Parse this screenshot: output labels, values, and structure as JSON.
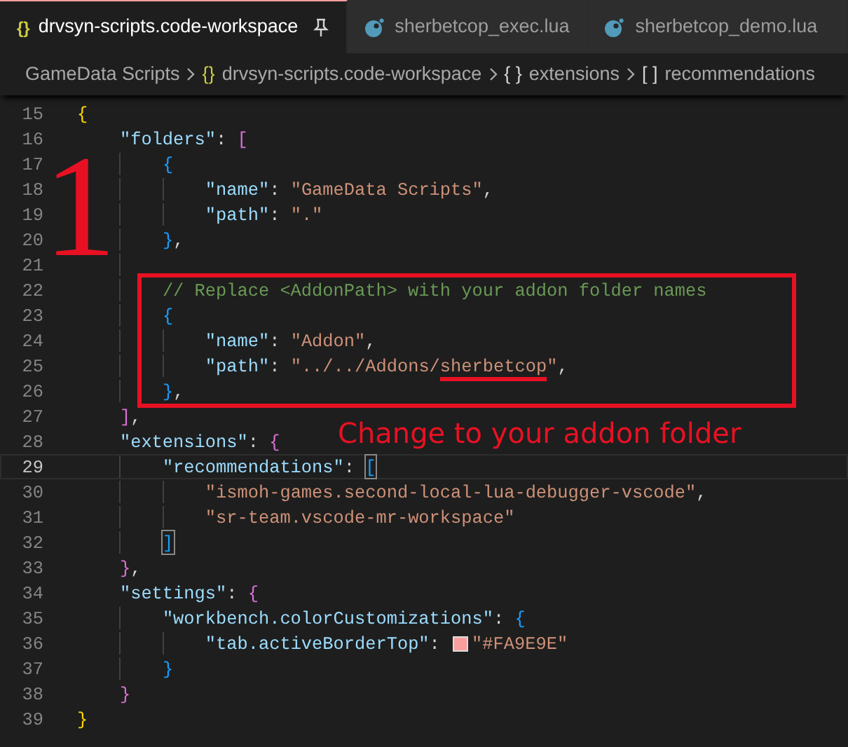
{
  "tabs": [
    {
      "label": "drvsyn-scripts.code-workspace",
      "kind": "json",
      "icon_text": "{}",
      "selected": true,
      "pinned": true
    },
    {
      "label": "sherbetcop_exec.lua",
      "kind": "lua",
      "selected": false,
      "pinned": false
    },
    {
      "label": "sherbetcop_demo.lua",
      "kind": "lua",
      "selected": false,
      "pinned": false
    }
  ],
  "breadcrumbs": [
    {
      "label": "GameData Scripts"
    },
    {
      "icon_text": "{}",
      "kind": "json",
      "label": "drvsyn-scripts.code-workspace"
    },
    {
      "icon_text": "{ }",
      "kind": "object",
      "label": "extensions"
    },
    {
      "icon_text": "[ ]",
      "kind": "array",
      "label": "recommendations"
    }
  ],
  "lines": [
    {
      "number": "15",
      "tokens": [
        {
          "kind": "b1",
          "text": "{"
        }
      ]
    },
    {
      "number": "16",
      "tokens": [
        {
          "kind": "key",
          "text": "\"folders\""
        },
        {
          "kind": "punct",
          "text": ":"
        },
        {
          "kind": "b2",
          "text": "["
        }
      ]
    },
    {
      "number": "17",
      "tokens": [
        {
          "kind": "b3",
          "text": "{"
        }
      ]
    },
    {
      "number": "18",
      "tokens": [
        {
          "kind": "key",
          "text": "\"name\""
        },
        {
          "kind": "punct",
          "text": ":"
        },
        {
          "kind": "string",
          "text": "\"GameData Scripts\""
        },
        {
          "kind": "punct",
          "text": ","
        }
      ]
    },
    {
      "number": "19",
      "tokens": [
        {
          "kind": "key",
          "text": "\"path\""
        },
        {
          "kind": "punct",
          "text": ":"
        },
        {
          "kind": "string",
          "text": "\".\""
        }
      ]
    },
    {
      "number": "20",
      "tokens": [
        {
          "kind": "b3",
          "text": "}"
        },
        {
          "kind": "punct",
          "text": ","
        }
      ]
    },
    {
      "number": "21"
    },
    {
      "number": "22",
      "boxed": true,
      "tokens": [
        {
          "kind": "comment",
          "text": "// Replace <AddonPath> with your addon folder names"
        }
      ]
    },
    {
      "number": "23",
      "boxed": true,
      "tokens": [
        {
          "kind": "b3",
          "text": "{"
        }
      ]
    },
    {
      "number": "24",
      "boxed": true,
      "tokens": [
        {
          "kind": "key",
          "text": "\"name\""
        },
        {
          "kind": "punct",
          "text": ":"
        },
        {
          "kind": "string",
          "text": "\"Addon\""
        },
        {
          "kind": "punct",
          "text": ","
        }
      ]
    },
    {
      "number": "25",
      "boxed": true,
      "tokens": [
        {
          "kind": "key",
          "text": "\"path\""
        },
        {
          "kind": "punct",
          "text": ":"
        },
        {
          "kind": "string",
          "text": "\"../../Addons/"
        },
        {
          "kind": "string",
          "text": "sherbetcop",
          "underlined": true
        },
        {
          "kind": "string",
          "text": "\""
        },
        {
          "kind": "punct",
          "text": ","
        }
      ]
    },
    {
      "number": "26",
      "boxed": true,
      "tokens": [
        {
          "kind": "b3",
          "text": "}"
        },
        {
          "kind": "punct",
          "text": ","
        }
      ]
    },
    {
      "number": "27",
      "tokens": [
        {
          "kind": "b2",
          "text": "]"
        },
        {
          "kind": "punct",
          "text": ","
        }
      ]
    },
    {
      "number": "28",
      "tokens": [
        {
          "kind": "key",
          "text": "\"extensions\""
        },
        {
          "kind": "punct",
          "text": ":"
        },
        {
          "kind": "b2",
          "text": "{"
        }
      ]
    },
    {
      "number": "29",
      "current": true,
      "tokens": [
        {
          "kind": "key",
          "text": "\"recommendations\""
        },
        {
          "kind": "punct",
          "text": ":"
        },
        {
          "kind": "b3",
          "text": "[",
          "matched": true
        }
      ]
    },
    {
      "number": "30",
      "tokens": [
        {
          "kind": "string",
          "text": "\"ismoh-games.second-local-lua-debugger-vscode\""
        },
        {
          "kind": "punct",
          "text": ","
        }
      ]
    },
    {
      "number": "31",
      "tokens": [
        {
          "kind": "string",
          "text": "\"sr-team.vscode-mr-workspace\""
        }
      ]
    },
    {
      "number": "32",
      "tokens": [
        {
          "kind": "b3",
          "text": "]",
          "matched": true
        }
      ]
    },
    {
      "number": "33",
      "tokens": [
        {
          "kind": "b2",
          "text": "}"
        },
        {
          "kind": "punct",
          "text": ","
        }
      ]
    },
    {
      "number": "34",
      "tokens": [
        {
          "kind": "key",
          "text": "\"settings\""
        },
        {
          "kind": "punct",
          "text": ":"
        },
        {
          "kind": "b2",
          "text": "{"
        }
      ]
    },
    {
      "number": "35",
      "tokens": [
        {
          "kind": "key",
          "text": "\"workbench.colorCustomizations\""
        },
        {
          "kind": "punct",
          "text": ":"
        },
        {
          "kind": "b3",
          "text": "{"
        }
      ]
    },
    {
      "number": "36",
      "tokens": [
        {
          "kind": "key",
          "text": "\"tab.activeBorderTop\""
        },
        {
          "kind": "punct",
          "text": ":"
        },
        {
          "kind": "swatch",
          "color": "#fa9e9e"
        },
        {
          "kind": "string",
          "text": "\"#FA9E9E\""
        }
      ]
    },
    {
      "number": "37",
      "tokens": [
        {
          "kind": "b3",
          "text": "}"
        }
      ]
    },
    {
      "number": "38",
      "tokens": [
        {
          "kind": "b2",
          "text": "}"
        }
      ]
    },
    {
      "number": "39",
      "tokens": [
        {
          "kind": "b1",
          "text": "}"
        }
      ]
    }
  ],
  "annotations": {
    "step_number": "1",
    "callout": "Change to your addon folder"
  }
}
